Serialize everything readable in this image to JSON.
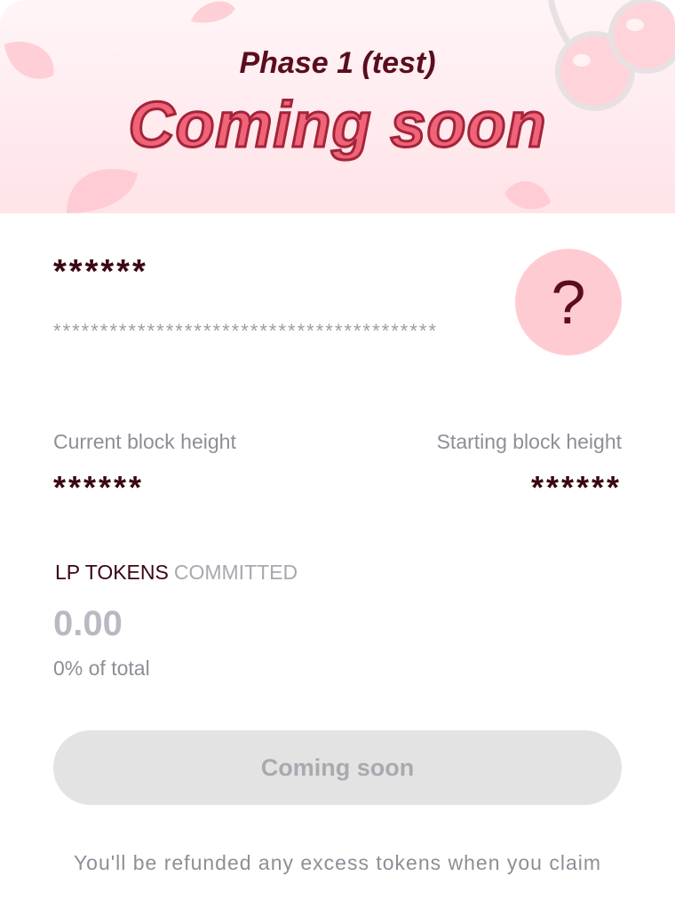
{
  "header": {
    "phase": "Phase 1 (test)",
    "title": "Coming soon"
  },
  "pool": {
    "name": "******",
    "description": "*****************************************",
    "badge_glyph": "?"
  },
  "blocks": {
    "current_label": "Current block height",
    "current_value": "******",
    "starting_label": "Starting block height",
    "starting_value": "******"
  },
  "committed": {
    "label_primary": "LP TOKENS",
    "label_secondary": "COMMITTED",
    "amount": "0.00",
    "percent_text": "0% of total"
  },
  "action": {
    "button_label": "Coming soon"
  },
  "footer": {
    "note": "You'll be refunded any excess tokens when you claim"
  },
  "colors": {
    "accent": "#ef6478",
    "dark": "#3a0712",
    "badge": "#ffcbd3"
  }
}
